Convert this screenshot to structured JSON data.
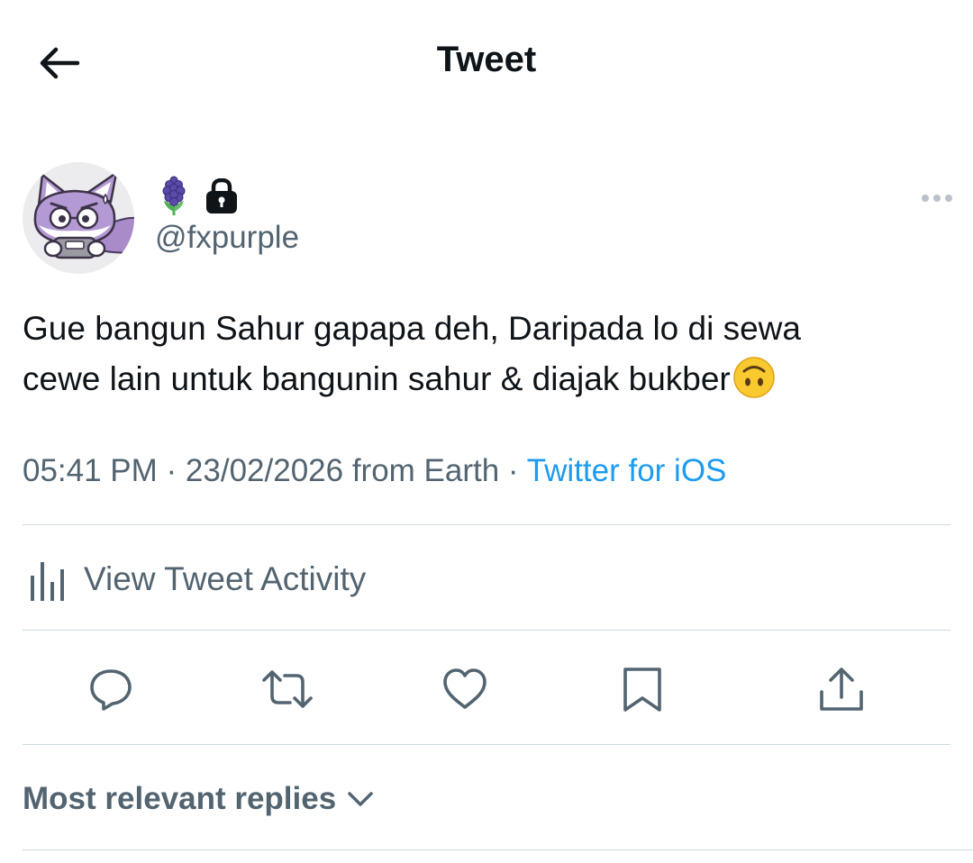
{
  "header": {
    "title": "Tweet",
    "back_icon": "arrow-left-icon"
  },
  "author": {
    "display_name_icons": [
      "hyacinth-emoji",
      "lock-icon"
    ],
    "handle": "@fxpurple",
    "avatar": "purple-fox-avatar"
  },
  "tweet": {
    "line1": "Gue bangun Sahur gapapa deh, Daripada lo di sewa",
    "line2": "cewe lain untuk bangunin sahur & diajak bukber",
    "trailing_emoji": "upside-down-face-emoji"
  },
  "meta": {
    "time": "05:41 PM",
    "sep1": " · ",
    "date": "23/02/2026",
    "location": " from Earth",
    "sep2": " · ",
    "source": "Twitter for iOS"
  },
  "activity": {
    "label": "View Tweet Activity",
    "icon": "bar-chart-icon"
  },
  "actions": [
    "reply-icon",
    "retweet-icon",
    "like-icon",
    "bookmark-icon",
    "share-icon"
  ],
  "replies": {
    "label": "Most relevant replies",
    "icon": "chevron-down-icon"
  },
  "colors": {
    "text_primary": "#0f1419",
    "text_secondary": "#536471",
    "link": "#1d9bf0",
    "divider": "#cfd9de",
    "lock_badge": "#0f1419"
  }
}
